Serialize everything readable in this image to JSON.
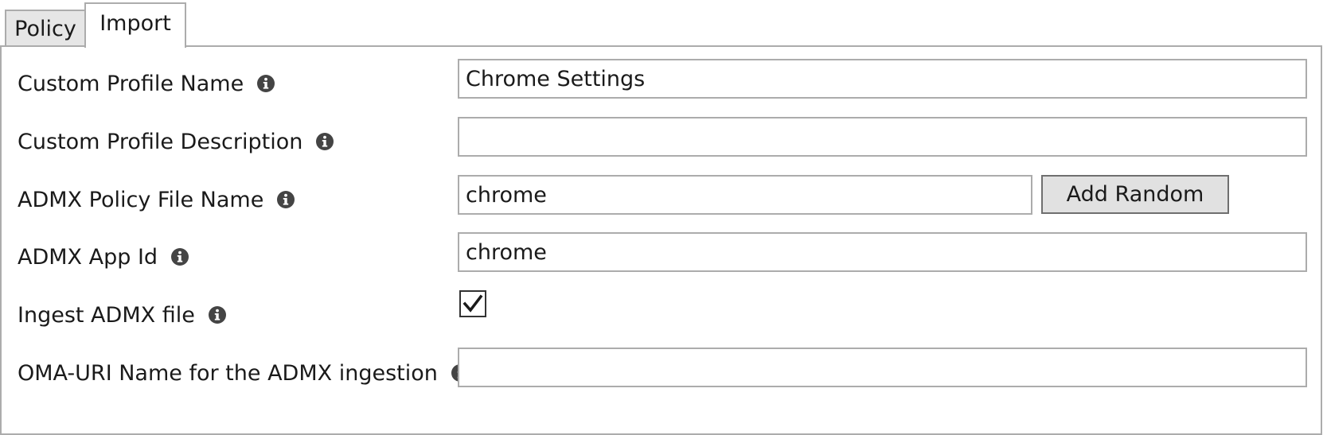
{
  "tabs": [
    {
      "label": "Policy",
      "active": false
    },
    {
      "label": "Import",
      "active": true
    }
  ],
  "form": {
    "profile_name": {
      "label": "Custom Profile Name",
      "value": "Chrome Settings",
      "info_icon": "info-icon"
    },
    "profile_description": {
      "label": "Custom Profile Description",
      "value": "",
      "info_icon": "info-icon"
    },
    "admx_file_name": {
      "label": "ADMX Policy File Name",
      "value": "chrome",
      "info_icon": "info-icon",
      "button_label": "Add Random"
    },
    "admx_app_id": {
      "label": "ADMX App Id",
      "value": "chrome",
      "info_icon": "info-icon"
    },
    "ingest_admx": {
      "label": "Ingest ADMX file",
      "checked": true,
      "info_icon": "info-icon"
    },
    "oma_uri_name": {
      "label": "OMA-URI Name for the ADMX ingestion",
      "value": "",
      "info_icon": "info-icon"
    }
  },
  "colors": {
    "border": "#acacac",
    "button_bg": "#e1e1e1",
    "tab_inactive_bg": "#e6e6e6",
    "icon": "#444444"
  }
}
